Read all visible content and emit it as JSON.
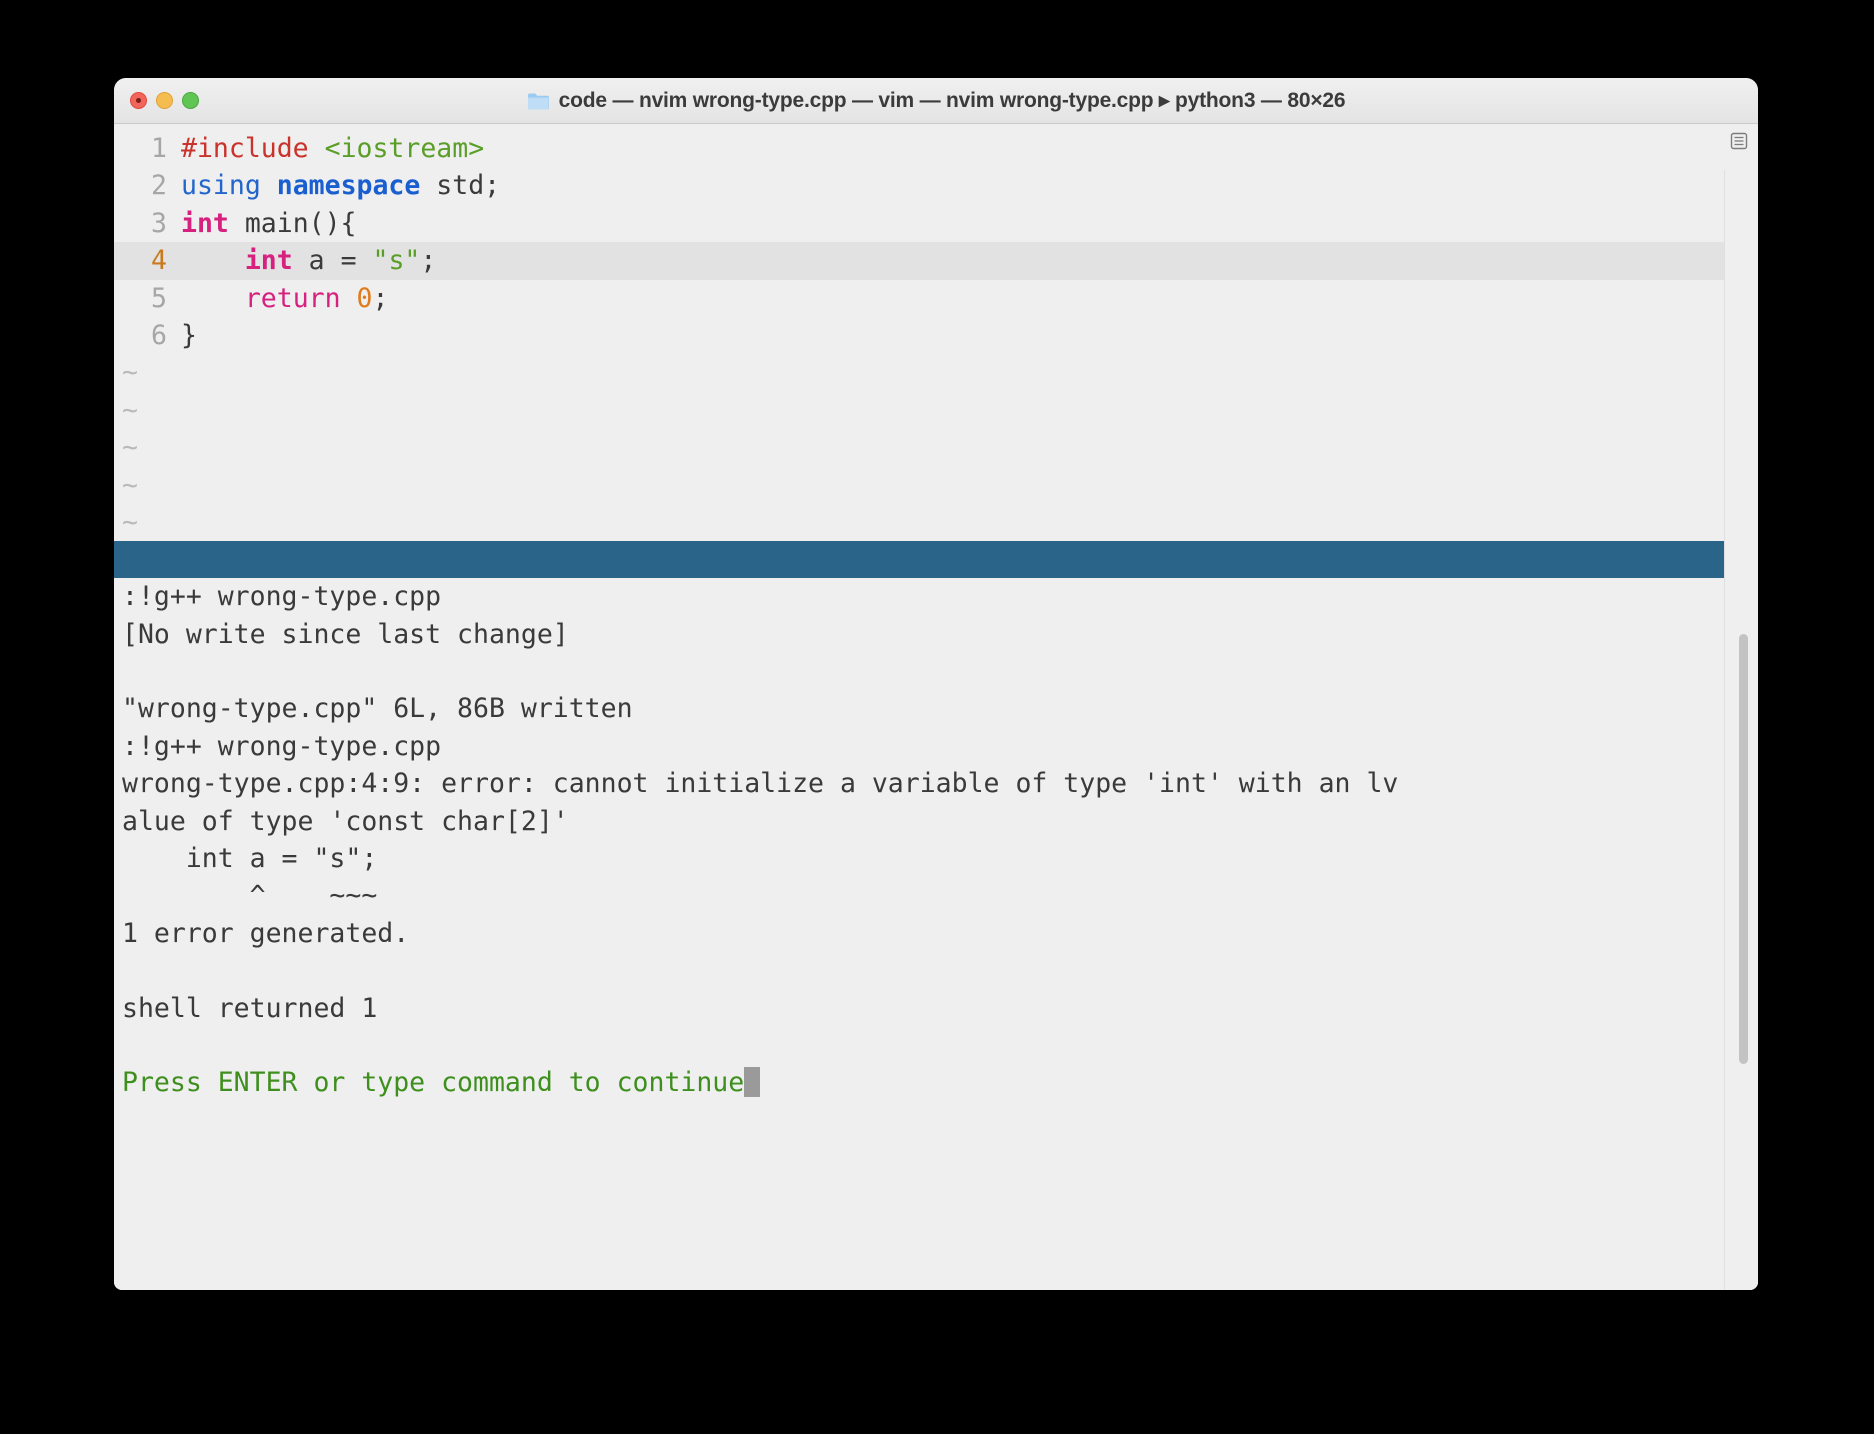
{
  "window": {
    "title": "code — nvim wrong-type.cpp — vim — nvim wrong-type.cpp ▸ python3 — 80×26",
    "folder_icon": "folder-icon",
    "traffic_lights": {
      "close": "close-button",
      "minimize": "minimize-button",
      "maximize": "maximize-button"
    },
    "colors": {
      "background": "#efefef",
      "statusbar": "#2b6489",
      "current_line": "#e2e2e2",
      "cursor": "#9a9a9a",
      "close": "#f2655a",
      "minimize": "#f5bd4f",
      "maximize": "#61c554"
    }
  },
  "editor": {
    "filename": "wrong-type.cpp",
    "current_line": 4,
    "lines": [
      {
        "number": "1",
        "tokens": [
          {
            "text": "#include",
            "style": "t-pre"
          },
          {
            "text": " ",
            "style": "t-plain"
          },
          {
            "text": "<iostream>",
            "style": "t-inc"
          }
        ]
      },
      {
        "number": "2",
        "tokens": [
          {
            "text": "using",
            "style": "t-kw"
          },
          {
            "text": " ",
            "style": "t-plain"
          },
          {
            "text": "namespace",
            "style": "t-kwb"
          },
          {
            "text": " std;",
            "style": "t-plain"
          }
        ]
      },
      {
        "number": "3",
        "tokens": [
          {
            "text": "int",
            "style": "t-type"
          },
          {
            "text": " main(){",
            "style": "t-plain"
          }
        ]
      },
      {
        "number": "4",
        "tokens": [
          {
            "text": "    ",
            "style": "t-plain"
          },
          {
            "text": "int",
            "style": "t-type"
          },
          {
            "text": " a = ",
            "style": "t-plain"
          },
          {
            "text": "\"s\"",
            "style": "t-str"
          },
          {
            "text": ";",
            "style": "t-plain"
          }
        ]
      },
      {
        "number": "5",
        "tokens": [
          {
            "text": "    ",
            "style": "t-plain"
          },
          {
            "text": "return",
            "style": "t-stmt"
          },
          {
            "text": " ",
            "style": "t-plain"
          },
          {
            "text": "0",
            "style": "t-num"
          },
          {
            "text": ";",
            "style": "t-plain"
          }
        ]
      },
      {
        "number": "6",
        "tokens": [
          {
            "text": "}",
            "style": "t-plain"
          }
        ]
      }
    ],
    "empty_markers": [
      "~",
      "~",
      "~",
      "~",
      "~"
    ]
  },
  "output": {
    "lines": [
      {
        "text": ":!g++ wrong-type.cpp",
        "style": ""
      },
      {
        "text": "[No write since last change]",
        "style": ""
      },
      {
        "text": "",
        "style": "blank"
      },
      {
        "text": "\"wrong-type.cpp\" 6L, 86B written",
        "style": ""
      },
      {
        "text": ":!g++ wrong-type.cpp",
        "style": ""
      },
      {
        "text": "wrong-type.cpp:4:9: error: cannot initialize a variable of type 'int' with an lv",
        "style": ""
      },
      {
        "text": "alue of type 'const char[2]'",
        "style": ""
      },
      {
        "text": "    int a = \"s\";",
        "style": ""
      },
      {
        "text": "        ^    ~~~",
        "style": ""
      },
      {
        "text": "1 error generated.",
        "style": ""
      },
      {
        "text": "",
        "style": "blank"
      },
      {
        "text": "shell returned 1",
        "style": ""
      },
      {
        "text": "",
        "style": "blank"
      },
      {
        "text": "Press ENTER or type command to continue",
        "style": "green"
      }
    ]
  }
}
